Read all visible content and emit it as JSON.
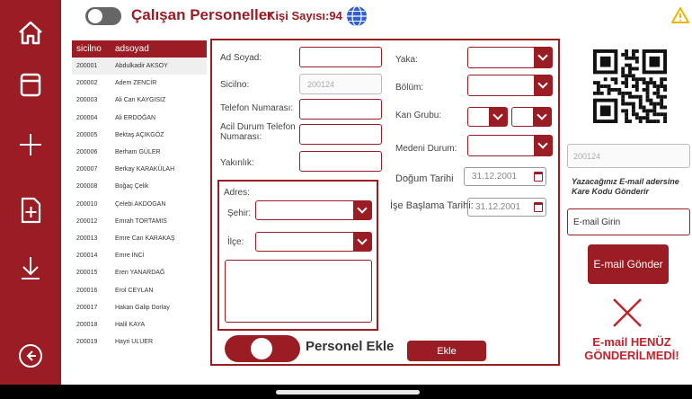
{
  "header": {
    "title": "Çalışan Personeller",
    "count_label": "Kişi Sayısı:94"
  },
  "sidebar": {
    "icons": [
      "home-icon",
      "window-icon",
      "plus-icon",
      "file-add-icon",
      "download-icon",
      "back-icon"
    ]
  },
  "list": {
    "columns": [
      "sicilno",
      "adsoyad"
    ],
    "rows": [
      {
        "no": "200001",
        "name": "Abdulkadir AKSOY"
      },
      {
        "no": "200002",
        "name": "Adem ZENCİR"
      },
      {
        "no": "200003",
        "name": "Ali Can KAYGISIZ"
      },
      {
        "no": "200004",
        "name": "Ali ERDOĞAN"
      },
      {
        "no": "200005",
        "name": "Bektaş AÇIKGÖZ"
      },
      {
        "no": "200006",
        "name": "Berham GÜLER"
      },
      {
        "no": "200007",
        "name": "Berkay KARAKÜLAH"
      },
      {
        "no": "200008",
        "name": "Boğaç Çelik"
      },
      {
        "no": "200010",
        "name": "Çelebi AKDOGAN"
      },
      {
        "no": "200012",
        "name": "Emrah TORTAMIS"
      },
      {
        "no": "200013",
        "name": "Emre Can KARAKAŞ"
      },
      {
        "no": "200014",
        "name": "Emre İNCİ"
      },
      {
        "no": "200015",
        "name": "Eren YANARDAĞ"
      },
      {
        "no": "200016",
        "name": "Erol CEYLAN"
      },
      {
        "no": "200017",
        "name": "Hakan Galip Dorlay"
      },
      {
        "no": "200018",
        "name": "Halil KAYA"
      },
      {
        "no": "200019",
        "name": "Hayri ULUER"
      }
    ],
    "selected_index": 0
  },
  "form": {
    "ad_soyad_label": "Ad Soyad:",
    "sicilno_label": "Sicilno:",
    "sicilno_value": "200124",
    "telefon_label": "Telefon Numarası:",
    "acil_label": "Acil Durum Telefon Numarası:",
    "yakinlik_label": "Yakınlık:",
    "adres_label": "Adres:",
    "sehir_label": "Şehir:",
    "ilce_label": "İlçe:",
    "yaka_label": "Yaka:",
    "bolum_label": "Bölüm:",
    "kan_label": "Kan Grubu:",
    "medeni_label": "Medeni Durum:",
    "dogum_label": "Doğum Tarihi",
    "dogum_value": "31.12.2001",
    "ise_label": "İşe Başlama Tarihi:",
    "ise_value": "31.12.2001",
    "personel_ekle_label": "Personel Ekle",
    "ekle_button": "Ekle"
  },
  "right": {
    "qr_value": "200124",
    "note": "Yazacağınız E-mail adersine Kare Kodu Gönderir",
    "email_placeholder": "E-mail Girin",
    "send_button": "E-mail Gönder",
    "status": "E-mail HENÜZ GÖNDERİLMEDİ!"
  },
  "colors": {
    "brand": "#9a1d24",
    "status": "#c0242c"
  }
}
